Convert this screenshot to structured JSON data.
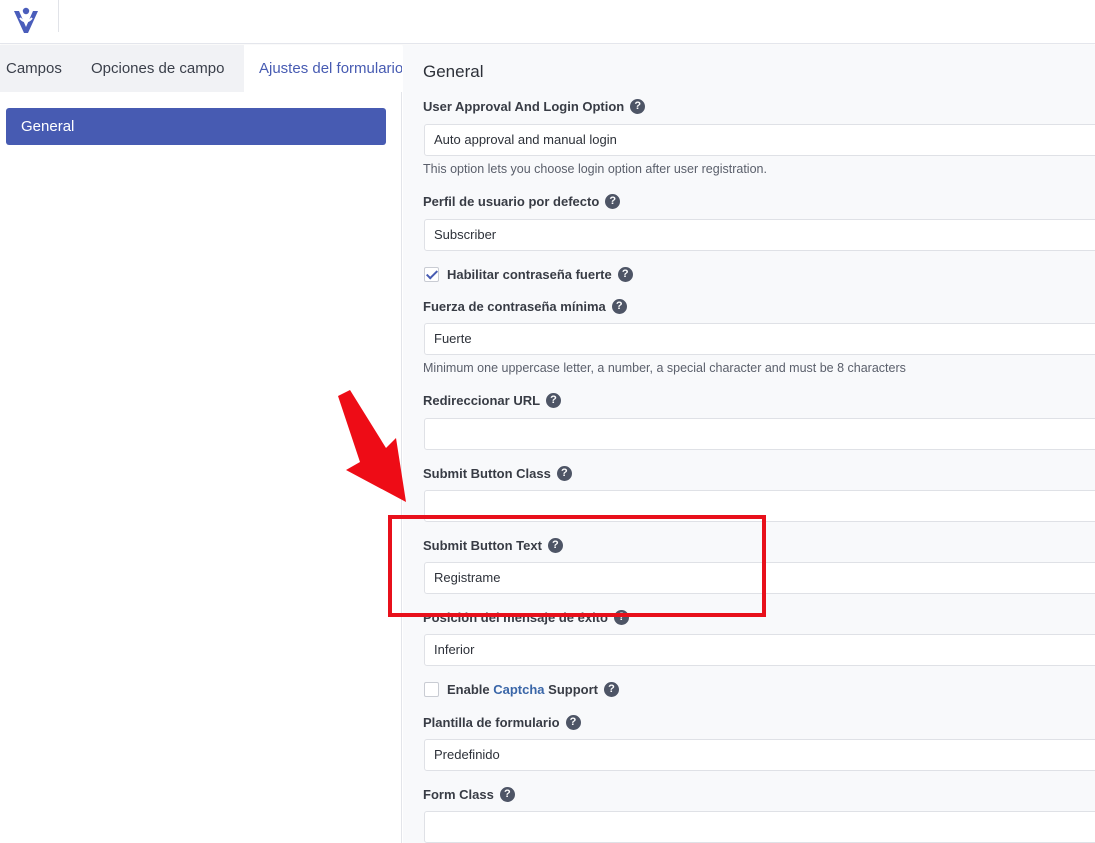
{
  "tabs": [
    "Campos",
    "Opciones de campo",
    "Ajustes del formulario"
  ],
  "sidebar": {
    "general_label": "General"
  },
  "main": {
    "section_title": "General",
    "fields": {
      "approval": {
        "label": "User Approval And Login Option",
        "value": "Auto approval and manual login",
        "description": "This option lets you choose login option after user registration."
      },
      "default_role": {
        "label": "Perfil de usuario por defecto",
        "value": "Subscriber"
      },
      "strong_password": {
        "label": "Habilitar contraseña fuerte",
        "checked": true
      },
      "min_strength": {
        "label": "Fuerza de contraseña mínima",
        "value": "Fuerte",
        "description": "Minimum one uppercase letter, a number, a special character and must be 8 characters"
      },
      "redirect_url": {
        "label": "Redireccionar URL",
        "value": ""
      },
      "submit_class": {
        "label": "Submit Button Class",
        "value": ""
      },
      "submit_text": {
        "label": "Submit Button Text",
        "value": "Registrame"
      },
      "success_position": {
        "label": "Posición del mensaje de éxito",
        "value": "Inferior"
      },
      "captcha": {
        "label_before": "Enable ",
        "label_link": "Captcha",
        "label_after": " Support",
        "checked": false
      },
      "form_template": {
        "label": "Plantilla de formulario",
        "value": "Predefinido"
      },
      "form_class": {
        "label": "Form Class",
        "value": ""
      }
    }
  },
  "help_glyph": "?",
  "colors": {
    "accent": "#475bb2",
    "annotation": "#e8101b",
    "logo": "#4a5dbb"
  }
}
